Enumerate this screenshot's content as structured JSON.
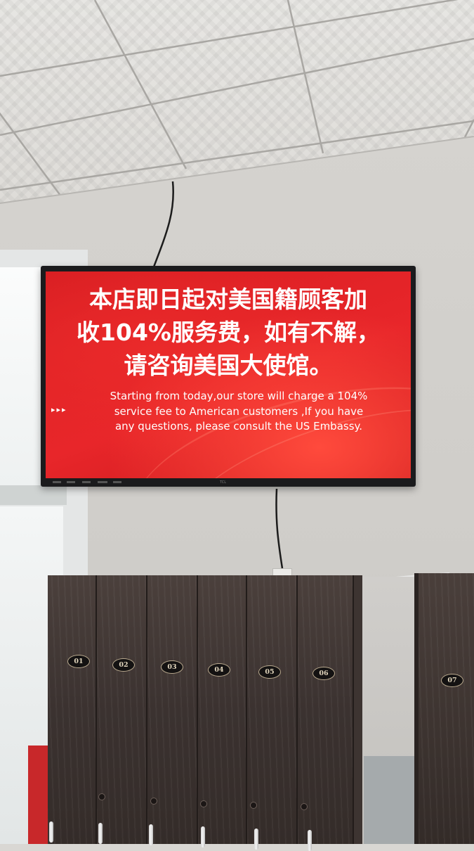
{
  "sign": {
    "chinese_lines": [
      "本店即日起对美国籍顾客加",
      "收104%服务费，如有不解，",
      "请咨询美国大使馆。"
    ],
    "english_lines": [
      "Starting from today,our store will charge a 104%",
      "service fee to American customers ,If you have",
      "any questions, please consult the US Embassy."
    ],
    "arrows": "▸▸▸",
    "tv_brand": "TCL"
  },
  "lockers": {
    "numbers": [
      "01",
      "02",
      "03",
      "04",
      "05",
      "06",
      "07"
    ]
  },
  "colors": {
    "screen_red": "#e02428",
    "locker_wood": "#3f3532"
  }
}
